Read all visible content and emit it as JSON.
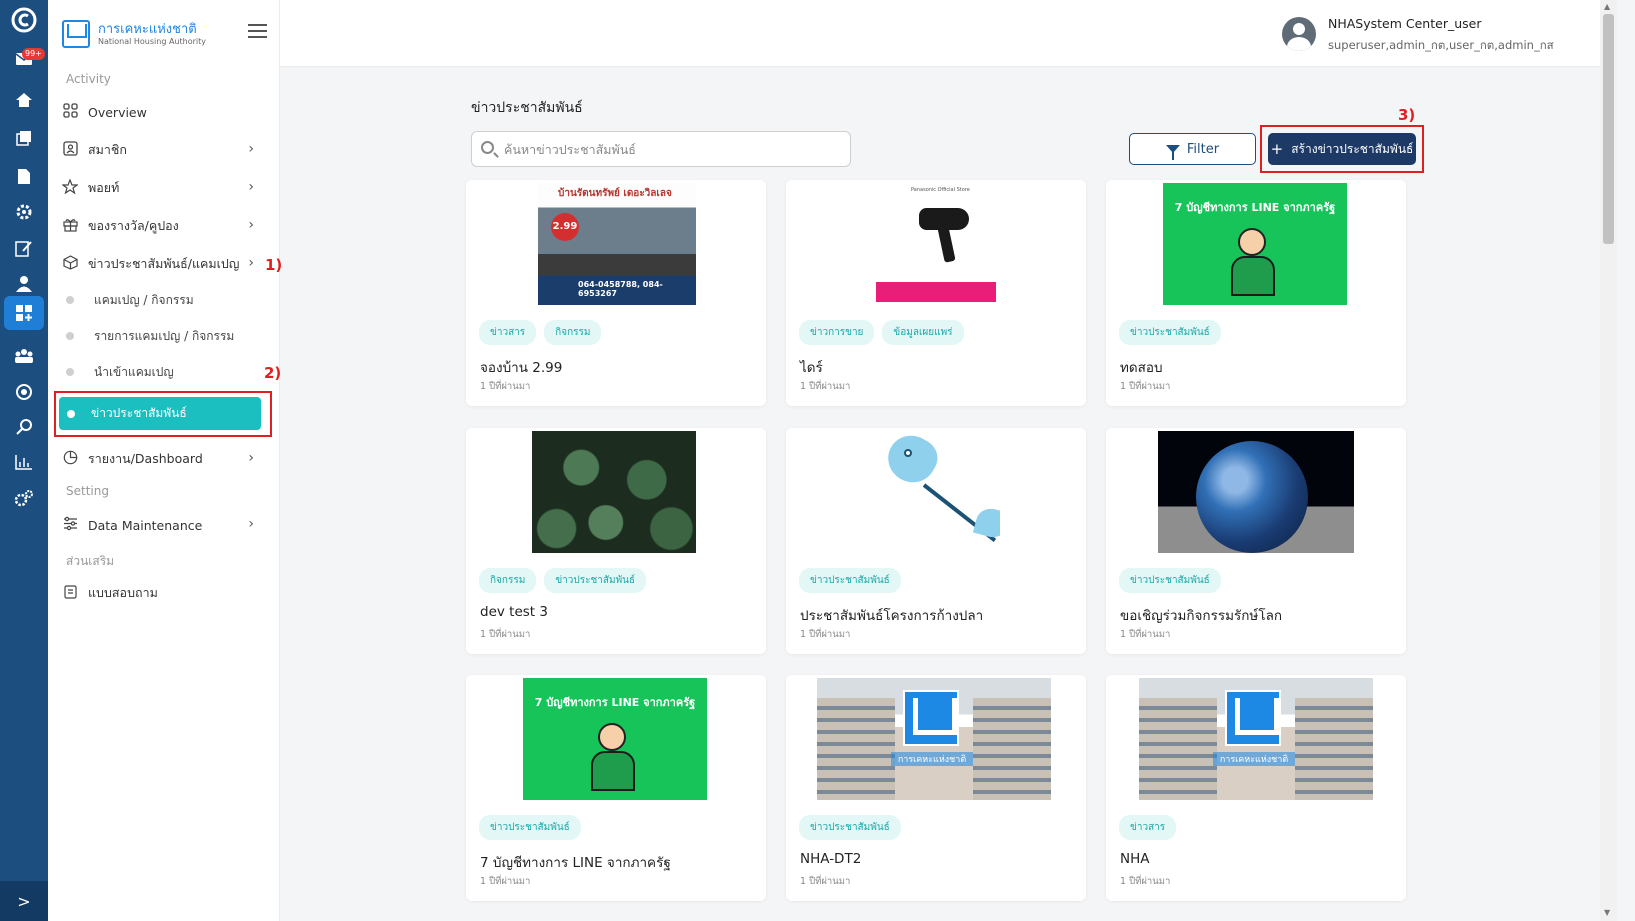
{
  "rail": {
    "badge": "99+",
    "icons": [
      "logo-icon",
      "mail-icon",
      "home-icon",
      "copy-icon",
      "document-icon",
      "settings-icon",
      "edit-icon",
      "user-icon",
      "dashboard-icon",
      "group-icon",
      "badge-icon",
      "search-icon",
      "chart-icon",
      "gears-icon"
    ],
    "expand": ">"
  },
  "brand": {
    "name_th": "การเคหะแห่งชาติ",
    "name_en": "National Housing Authority"
  },
  "sidebar": {
    "section_activity": "Activity",
    "section_setting": "Setting",
    "section_extra": "ส่วนเสริม",
    "overview": "Overview",
    "members": "สมาชิก",
    "points": "พอยท์",
    "rewards": "ของรางวัล/คูปอง",
    "news_campaign": "ข่าวประชาสัมพันธ์/แคมเปญ",
    "sub_campaign": "แคมเปญ / กิจกรรม",
    "sub_campaign_list": "รายการแคมเปญ / กิจกรรม",
    "sub_import": "นำเข้าแคมเปญ",
    "sub_news": "ข่าวประชาสัมพันธ์",
    "report": "รายงาน/Dashboard",
    "data_maintenance": "Data Maintenance",
    "survey": "แบบสอบถาม"
  },
  "callouts": [
    "1)",
    "2)",
    "3)"
  ],
  "user": {
    "name": "NHASystem Center_user",
    "roles": "superuser,admin_กต,user_กต,admin_กส"
  },
  "main": {
    "title": "ข่าวประชาสัมพันธ์",
    "search_placeholder": "ค้นหาข่าวประชาสัมพันธ์",
    "filter_label": "Filter",
    "create_label": "สร้างข่าวประชาสัมพันธ์"
  },
  "cards": [
    {
      "tags": [
        "ข่าวสาร",
        "กิจกรรม"
      ],
      "title": "จองบ้าน 2.99",
      "time": "1 ปีที่ผ่านมา"
    },
    {
      "tags": [
        "ข่าวการขาย",
        "ข้อมูลเผยแพร่"
      ],
      "title": "ไดร์",
      "time": "1 ปีที่ผ่านมา"
    },
    {
      "tags": [
        "ข่าวประชาสัมพันธ์"
      ],
      "title": "ทดสอบ",
      "time": "1 ปีที่ผ่านมา"
    },
    {
      "tags": [
        "กิจกรรม",
        "ข่าวประชาสัมพันธ์"
      ],
      "title": "dev test 3",
      "time": "1 ปีที่ผ่านมา"
    },
    {
      "tags": [
        "ข่าวประชาสัมพันธ์"
      ],
      "title": "ประชาสัมพันธ์โครงการก้างปลา",
      "time": "1 ปีที่ผ่านมา"
    },
    {
      "tags": [
        "ข่าวประชาสัมพันธ์"
      ],
      "title": "ขอเชิญร่วมกิจกรรมรักษ์โลก",
      "time": "1 ปีที่ผ่านมา"
    },
    {
      "tags": [
        "ข่าวประชาสัมพันธ์"
      ],
      "title": "7 บัญชีทางการ LINE จากภาครัฐ",
      "time": "1 ปีที่ผ่านมา"
    },
    {
      "tags": [
        "ข่าวประชาสัมพันธ์"
      ],
      "title": "NHA-DT2",
      "time": "1 ปีที่ผ่านมา"
    },
    {
      "tags": [
        "ข่าวสาร"
      ],
      "title": "NHA",
      "time": "1 ปีที่ผ่านมา"
    }
  ],
  "thumbnails": {
    "house_headline": "บ้านรัตนทรัพย์ เดอะวิลเลจ",
    "house_price": "2.99",
    "house_phone": "064-0458788, 084-6953267",
    "dryer_brand": "Panasonic Official Store",
    "line_headline": "7 บัญชีทางการ LINE จากภาครัฐ",
    "nha_logo_text": "การเคหะแห่งชาติ"
  },
  "colors": {
    "rail": "#1d4e80",
    "active_item": "#1bbfbf",
    "primary_button": "#1d3a66",
    "callout": "#e02020",
    "tag_bg": "#e3f7f6",
    "tag_text": "#1aa8a8"
  }
}
